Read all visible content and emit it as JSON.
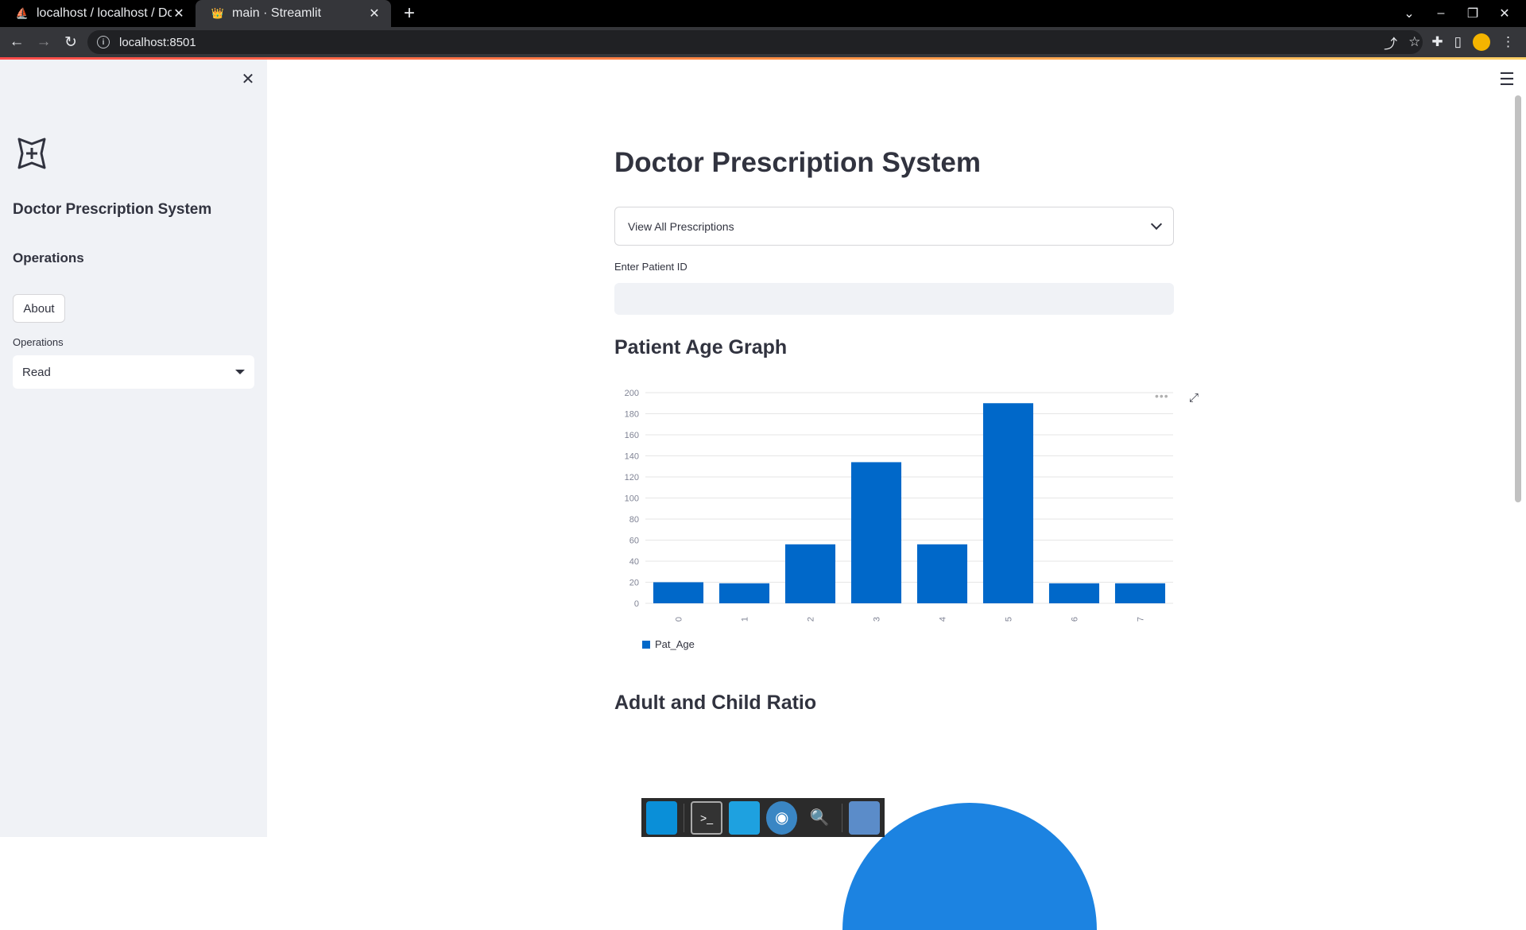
{
  "browser": {
    "tabs": [
      {
        "title": "localhost / localhost / Doct",
        "favicon": "phpmyadmin-icon",
        "active": false
      },
      {
        "title": "main · Streamlit",
        "favicon": "streamlit-icon",
        "active": true
      }
    ],
    "url": "localhost:8501"
  },
  "sidebar": {
    "title": "Doctor Prescription System",
    "section_heading": "Operations",
    "about_label": "About",
    "select_label": "Operations",
    "select_value": "Read"
  },
  "main": {
    "title": "Doctor Prescription System",
    "expander_label": "View All Prescriptions",
    "patient_id_label": "Enter Patient ID",
    "patient_id_value": "",
    "age_graph_heading": "Patient Age Graph",
    "ratio_heading": "Adult and Child Ratio"
  },
  "chart_data": {
    "type": "bar",
    "categories": [
      "0",
      "1",
      "2",
      "3",
      "4",
      "5",
      "6",
      "7"
    ],
    "series": [
      {
        "name": "Pat_Age",
        "values": [
          20,
          19,
          56,
          134,
          56,
          190,
          19,
          19
        ]
      }
    ],
    "yticks": [
      0,
      20,
      40,
      60,
      80,
      100,
      120,
      140,
      160,
      180,
      200
    ],
    "ylim": [
      0,
      200
    ],
    "legend_position": "bottom-left",
    "grid": true,
    "color": "#0068c9"
  },
  "dock": {
    "items": [
      "desktop-icon",
      "terminal-icon",
      "files-icon",
      "browser-icon",
      "search-icon",
      "folder-icon"
    ]
  }
}
